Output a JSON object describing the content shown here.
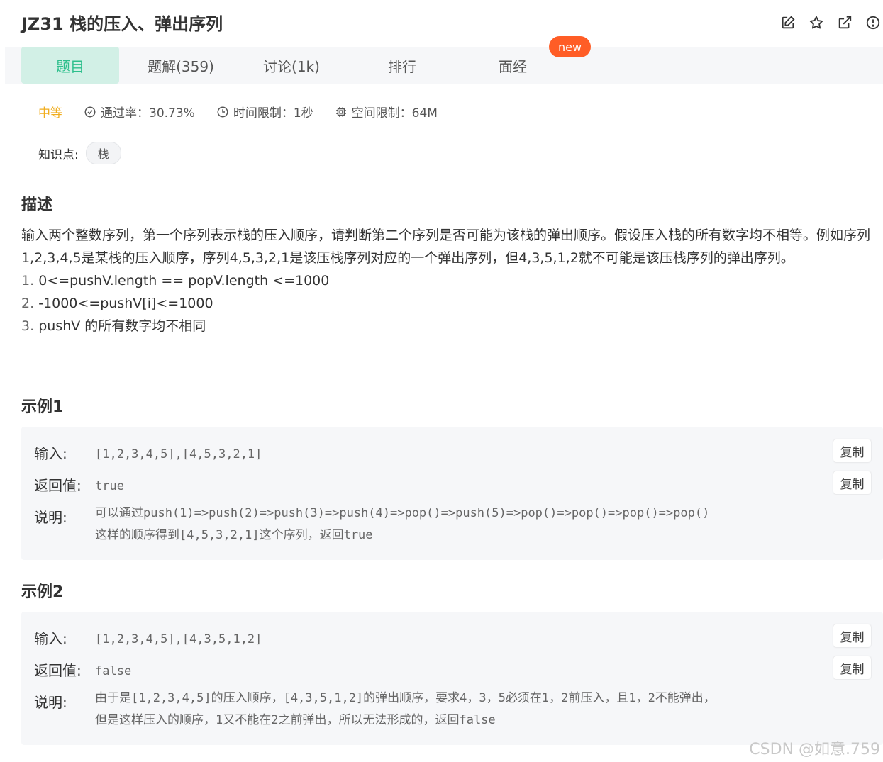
{
  "problem": {
    "title": "JZ31  栈的压入、弹出序列"
  },
  "tabs": [
    {
      "label": "题目"
    },
    {
      "label": "题解(359)"
    },
    {
      "label": "讨论(1k)"
    },
    {
      "label": "排行"
    },
    {
      "label": "面经"
    }
  ],
  "badge": {
    "new": "new"
  },
  "meta": {
    "difficulty": "中等",
    "pass_rate": "通过率：30.73%",
    "time_limit": "时间限制：1秒",
    "space_limit": "空间限制：64M"
  },
  "knowledge": {
    "label": "知识点:",
    "tag": "栈"
  },
  "description": {
    "heading": "描述",
    "paragraph": "输入两个整数序列，第一个序列表示栈的压入顺序，请判断第二个序列是否可能为该栈的弹出顺序。假设压入栈的所有数字均不相等。例如序列1,2,3,4,5是某栈的压入顺序，序列4,5,3,2,1是该压栈序列对应的一个弹出序列，但4,3,5,1,2就不可能是该压栈序列的弹出序列。",
    "items": [
      {
        "num": "1.",
        "text": "0<=pushV.length == popV.length <=1000"
      },
      {
        "num": "2.",
        "text": "-1000<=pushV[i]<=1000"
      },
      {
        "num": "3.",
        "text": "pushV 的所有数字均不相同"
      }
    ]
  },
  "examples": [
    {
      "heading": "示例1",
      "input_label": "输入:",
      "input": "[1,2,3,4,5],[4,5,3,2,1]",
      "return_label": "返回值:",
      "return": "true",
      "explain_label": "说明:",
      "explain_line1": "可以通过push(1)=>push(2)=>push(3)=>push(4)=>pop()=>push(5)=>pop()=>pop()=>pop()=>pop()",
      "explain_line2": "这样的顺序得到[4,5,3,2,1]这个序列，返回true",
      "copy_label": "复制"
    },
    {
      "heading": "示例2",
      "input_label": "输入:",
      "input": "[1,2,3,4,5],[4,3,5,1,2]",
      "return_label": "返回值:",
      "return": "false",
      "explain_label": "说明:",
      "explain_line1": "由于是[1,2,3,4,5]的压入顺序，[4,3,5,1,2]的弹出顺序，要求4，3，5必须在1，2前压入，且1，2不能弹出，",
      "explain_line2": "但是这样压入的顺序，1又不能在2之前弹出，所以无法形成的，返回false",
      "copy_label": "复制"
    }
  ],
  "watermark": "CSDN @如意.759",
  "colors": {
    "accent": "#2dbf8c",
    "tab_active_bg": "#d2f0e6",
    "difficulty": "#f0ad1e",
    "new_badge": "#ff5d26"
  }
}
